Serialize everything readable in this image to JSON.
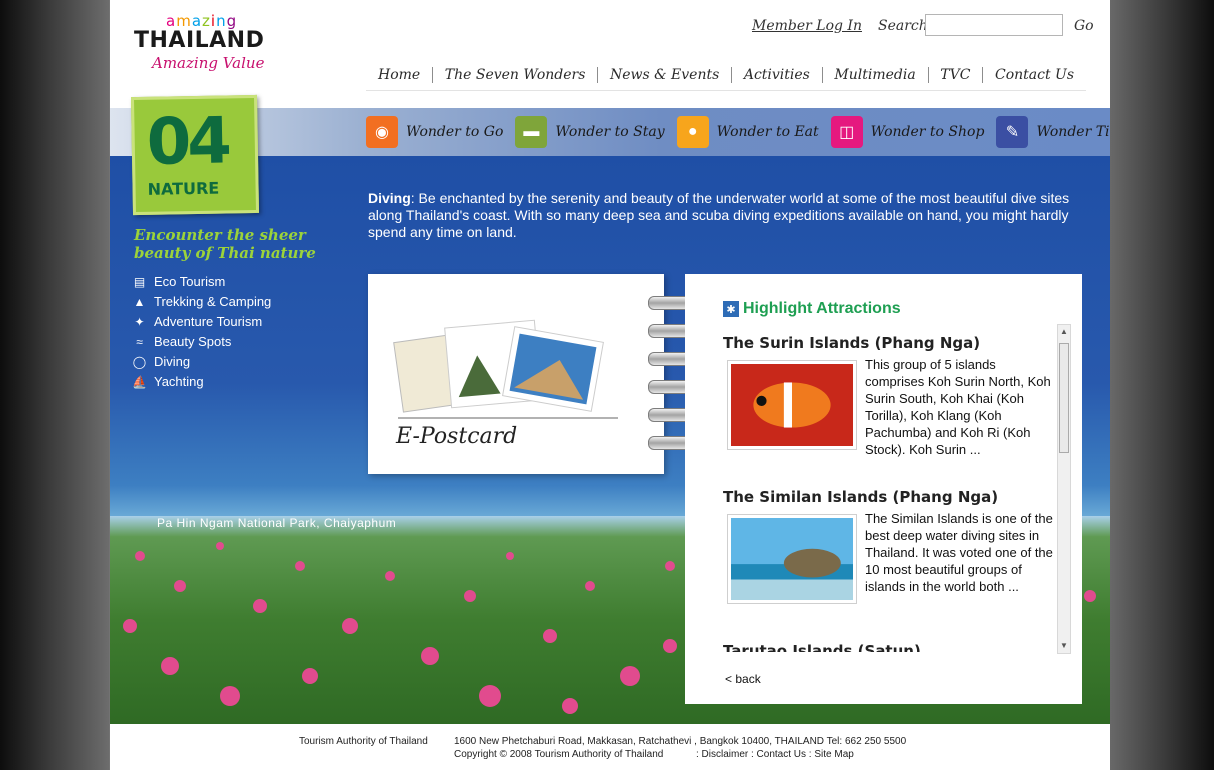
{
  "header": {
    "logo_amazing": "amazing",
    "logo_thailand": "THAILAND",
    "logo_value": "Amazing Value",
    "member_login": "Member Log In",
    "search_label": "Search",
    "search_value": "",
    "go_label": "Go"
  },
  "nav": [
    "Home",
    "The Seven Wonders",
    "News & Events",
    "Activities",
    "Multimedia",
    "TVC",
    "Contact Us"
  ],
  "wonders": [
    {
      "label": "Wonder to Go",
      "color": "#f26f21",
      "icon": "camera-icon"
    },
    {
      "label": "Wonder to Stay",
      "color": "#7fa53a",
      "icon": "bed-icon"
    },
    {
      "label": "Wonder to Eat",
      "color": "#f7a51c",
      "icon": "plate-icon"
    },
    {
      "label": "Wonder to Shop",
      "color": "#e5197f",
      "icon": "shopping-bag-icon"
    },
    {
      "label": "Wonder Tips",
      "color": "#3b4fa3",
      "icon": "notepad-icon"
    }
  ],
  "badge": {
    "number": "04",
    "category": "NATURE"
  },
  "tagline": "Encounter the sheer beauty of Thai nature",
  "side_menu": [
    {
      "label": "Eco Tourism",
      "icon": "binoculars-icon"
    },
    {
      "label": "Trekking & Camping",
      "icon": "tent-icon"
    },
    {
      "label": "Adventure Tourism",
      "icon": "climber-icon"
    },
    {
      "label": "Beauty Spots",
      "icon": "waterfall-icon"
    },
    {
      "label": "Diving",
      "icon": "diving-mask-icon"
    },
    {
      "label": "Yachting",
      "icon": "sailboat-icon"
    }
  ],
  "intro": {
    "heading": "Diving",
    "text": ": Be enchanted by the serenity and beauty of the underwater world at some of the most beautiful dive sites along Thailand's coast. With so many deep sea and scuba diving expeditions available on hand, you might hardly spend any time on land."
  },
  "postcard": {
    "title": "E-Postcard"
  },
  "highlights": {
    "title": "Highlight Attractions",
    "items": [
      {
        "title": "The Surin Islands (Phang Nga)",
        "description": "This group of 5 islands comprises Koh Surin North, Koh Surin South, Koh Khai (Koh Torilla), Koh Klang (Koh Pachumba) and Koh Ri (Koh Stock). Koh Surin ..."
      },
      {
        "title": "The Similan Islands (Phang Nga)",
        "description": "The Similan Islands is one of the best deep water diving sites in Thailand. It was voted one of the 10 most beautiful groups of islands in the world both ..."
      },
      {
        "title": "Tarutao Islands (Satun)",
        "description": ""
      }
    ],
    "back": "< back"
  },
  "photo_caption": "Pa Hin Ngam National Park, Chaiyaphum",
  "footer": {
    "org": "Tourism Authority of Thailand",
    "address": "1600 New Phetchaburi Road, Makkasan, Ratchathevi , Bangkok 10400, THAILAND Tel: 662 250 5500",
    "copyright": "Copyright ©",
    "year": "2008",
    "copyright_org": "Tourism Authority of Thailand",
    "links": ": Disclaimer : Contact Us : Site Map"
  }
}
